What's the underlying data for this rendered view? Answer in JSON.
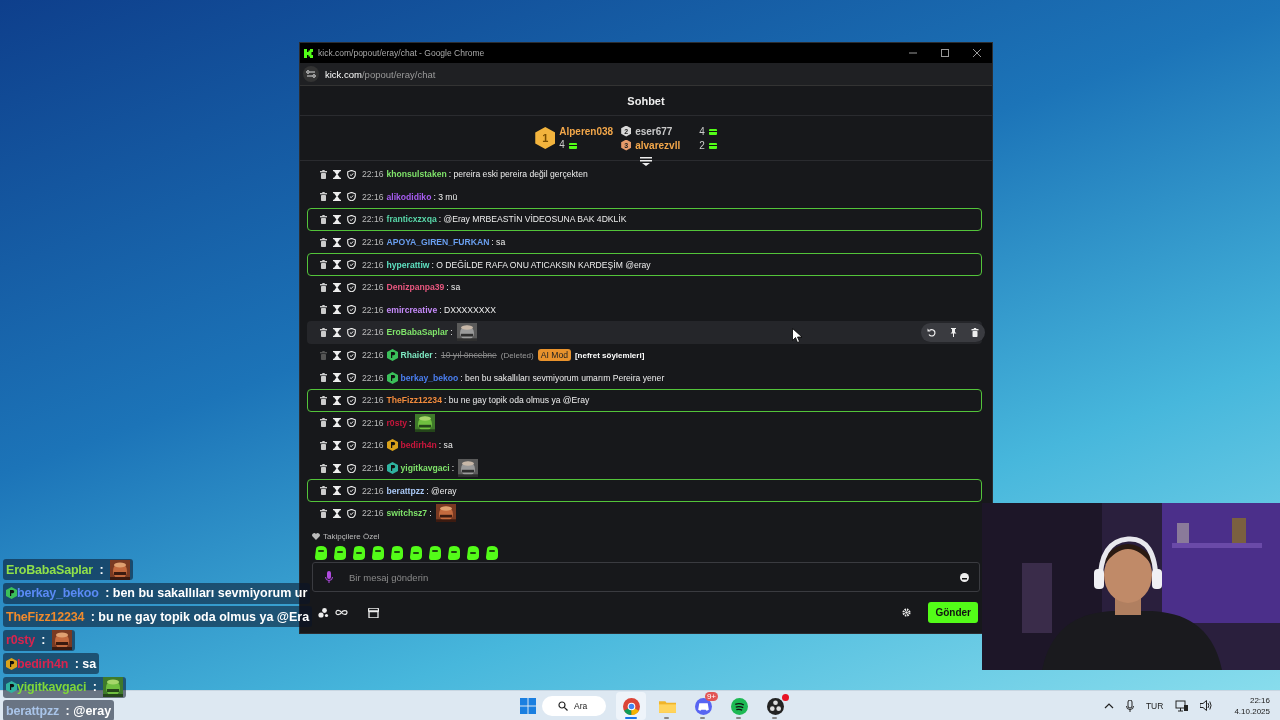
{
  "overlay_chat": [
    {
      "user": "EroBabaSaplar",
      "color": "#8fe04a",
      "text": " :"
    },
    {
      "user": "berkay_bekoo",
      "color": "#5a8af5",
      "badge": {
        "color": "#3bbf5a"
      },
      "text": " : ben bu sakallıları sevmiyorum ur"
    },
    {
      "user": "TheFizz12234",
      "color": "#f08a2c",
      "text": " : bu ne gay topik oda olmus ya @Era"
    },
    {
      "user": "r0sty",
      "color": "#d8244e",
      "text": " :"
    },
    {
      "user": "bedirh4n",
      "color": "#d8244e",
      "badge": {
        "color": "#d9a21b"
      },
      "text": " : sa"
    },
    {
      "user": "yigitkavgaci",
      "color": "#7fd63a",
      "badge": {
        "color": "#2fb3a0"
      },
      "text": " :"
    },
    {
      "user": "berattpzz",
      "color": "#a9c4e8",
      "text": " : @eray"
    }
  ],
  "browser": {
    "title": "kick.com/popout/eray/chat - Google Chrome",
    "url": {
      "host": "kick.com",
      "path": "/popout/eray/chat"
    }
  },
  "chat": {
    "title": "Sohbet",
    "leaderboard": [
      {
        "rank": "1",
        "name": "Alperen038",
        "count": "4",
        "color": "#f3a74a"
      },
      {
        "rank": "2",
        "name": "eser677",
        "count": "4",
        "color": "#c9c9c9"
      },
      {
        "rank": "3",
        "name": "alvarezvll",
        "count": "2",
        "color": "#f3a74a"
      }
    ],
    "messages": [
      {
        "time": "22:16",
        "user": "khonsulstaken",
        "color": "#7fe36a",
        "text": ": pereira eski pereira değil gerçekten",
        "mention": false,
        "hovered": false,
        "deleted": false
      },
      {
        "time": "22:16",
        "user": "alikodidiko",
        "color": "#a65cf0",
        "text": ": 3 mü",
        "mention": false,
        "hovered": false,
        "deleted": false
      },
      {
        "time": "22:16",
        "user": "franticxzxqa",
        "color": "#58d6a8",
        "text": ": @Eray MRBEASTİN VİDEOSUNA BAK 4DKLİK",
        "mention": true,
        "hovered": false,
        "deleted": false
      },
      {
        "time": "22:16",
        "user": "APOYA_GIREN_FURKAN",
        "color": "#6a9ff0",
        "text": ": sa",
        "mention": false,
        "hovered": false,
        "deleted": false
      },
      {
        "time": "22:16",
        "user": "hyperattiw",
        "color": "#5ee0c0",
        "text": ": O DEĞİLDE RAFA ONU ATICAKSIN KARDEŞİM @eray",
        "mention": true,
        "hovered": false,
        "deleted": false
      },
      {
        "time": "22:16",
        "user": "Denizpanpa39",
        "color": "#e8577f",
        "text": ": sa",
        "mention": false,
        "hovered": false,
        "deleted": false
      },
      {
        "time": "22:16",
        "user": "emircreative",
        "color": "#c58af9",
        "text": ": DXXXXXXXX",
        "mention": false,
        "hovered": false,
        "deleted": false
      },
      {
        "time": "22:16",
        "user": "EroBabaSaplar",
        "color": "#7fe36a",
        "text": ":",
        "mention": false,
        "hovered": true,
        "deleted": false
      },
      {
        "time": "22:16",
        "user": "Rhaider",
        "color": "#7ee8c2",
        "badge": {
          "color": "#3bbf5a"
        },
        "text": ":",
        "struck": "10 yıl öncebne",
        "note": "(Deleted)",
        "tag": "AI Mod",
        "reason": "[nefret söylemleri]",
        "mention": false,
        "hovered": false,
        "deleted": true
      },
      {
        "time": "22:16",
        "user": "berkay_bekoo",
        "color": "#4a7ef0",
        "badge": {
          "color": "#3bbf5a"
        },
        "text": ": ben bu sakallıları sevmiyorum umarım Pereira yener",
        "mention": false,
        "hovered": false,
        "deleted": false
      },
      {
        "time": "22:16",
        "user": "TheFizz12234",
        "color": "#f08a3c",
        "text": ": bu ne gay topik oda olmus ya @Eray",
        "mention": true,
        "hovered": false,
        "deleted": false
      },
      {
        "time": "22:16",
        "user": "r0sty",
        "color": "#c8163c",
        "text": ":",
        "mention": false,
        "hovered": false,
        "deleted": false
      },
      {
        "time": "22:16",
        "user": "bedirh4n",
        "color": "#c8163c",
        "badge": {
          "color": "#d9a21b"
        },
        "text": ": sa",
        "mention": false,
        "hovered": false,
        "deleted": false
      },
      {
        "time": "22:16",
        "user": "yigitkavgaci",
        "color": "#7fe36a",
        "badge": {
          "color": "#2fb3a0"
        },
        "text": ":",
        "mention": false,
        "hovered": false,
        "deleted": false
      },
      {
        "time": "22:16",
        "user": "berattpzz",
        "color": "#a9c8f5",
        "text": ": @eray",
        "mention": true,
        "hovered": false,
        "deleted": false
      },
      {
        "time": "22:16",
        "user": "switchsz7",
        "color": "#7fe36a",
        "text": ":",
        "mention": false,
        "hovered": false,
        "deleted": false
      }
    ],
    "followers_only": {
      "label": "Takipçilere Özel"
    },
    "input": {
      "placeholder": "Bir mesaj gönderin"
    },
    "send_button": "Gönder"
  },
  "taskbar": {
    "search": "Ara",
    "apps": [
      {
        "kind": "chrome",
        "active": true
      },
      {
        "kind": "files",
        "active": false
      },
      {
        "kind": "discord",
        "active": false,
        "badge": "9+"
      },
      {
        "kind": "spotify",
        "active": false
      },
      {
        "kind": "obs",
        "active": false,
        "alert": true
      }
    ],
    "language": "TUR",
    "time": "22:16",
    "date": "4.10.2025"
  }
}
